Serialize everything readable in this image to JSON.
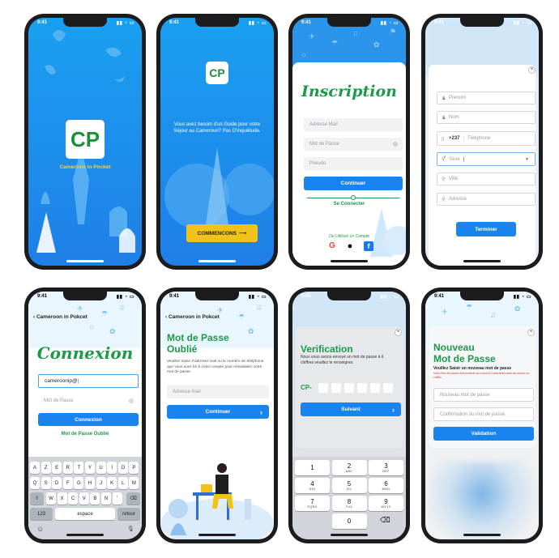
{
  "status_time": "9:41",
  "brand": {
    "name": "Cameroon in Pocket",
    "logo_letters": "CP",
    "green": "#1a8f3c",
    "yellow": "#f3c21a",
    "blue": "#1a84ee"
  },
  "splash": {
    "logo_caption": "Cameroon in Pocket"
  },
  "welcome": {
    "message": "Vous avez besoin d'un Guide pour votre Séjour au Cameroun? Pas D'inquiétude.",
    "cta_label": "COMMENCONS",
    "cta_arrow": "⟶"
  },
  "signup": {
    "title": "Inscription",
    "email_placeholder": "Adresse Mail",
    "password_placeholder": "Mot de Passe",
    "pseudo_placeholder": "Pseudo",
    "continue_label": "Continuer",
    "login_link": "Se Connecter",
    "social_caption": "Ou Utilisez un Compte"
  },
  "profile": {
    "firstname_placeholder": "Prénom",
    "lastname_placeholder": "Nom",
    "phone_code": "+237",
    "phone_placeholder": "Téléphone",
    "gender_placeholder": "Sexe",
    "city_placeholder": "Ville",
    "address_placeholder": "Adresse",
    "finish_label": "Terminer",
    "close_label": "×"
  },
  "login": {
    "back_label": "Cameroon in Pokcet",
    "title": "Connexion",
    "email_value": "cameroonip@",
    "password_placeholder": "Mot de Passe",
    "submit_label": "Connexion",
    "forgot_link": "Mot de Passe Oublié",
    "keyboard": {
      "row1": [
        "A",
        "Z",
        "E",
        "R",
        "T",
        "Y",
        "U",
        "I",
        "O",
        "P"
      ],
      "row2": [
        "Q",
        "S",
        "D",
        "F",
        "G",
        "H",
        "J",
        "K",
        "L",
        "M"
      ],
      "row3": [
        "W",
        "X",
        "C",
        "V",
        "B",
        "N",
        "'"
      ],
      "numbers_key": "123",
      "space_key": "espace",
      "return_key": "retour"
    }
  },
  "forgot": {
    "back_label": "Cameroon in Pokcet",
    "title_line1": "Mot de Passe",
    "title_line2": "Oublié",
    "description": "Veuillez saisir d'adresse mail ou le numéro de téléphone que vous avez lié à votre compte pour réinitialiser votre mot de passe.",
    "email_placeholder": "Adresse mail",
    "continue_label": "Continuer",
    "arrow": "›"
  },
  "verify": {
    "title": "Verification",
    "description": "Nous vous avons envoyé un mot de passe à 6 chiffres veuillez le renseigner.",
    "code_prefix": "CP-",
    "next_label": "Suivant",
    "arrow": "›",
    "close_label": "×",
    "numpad": [
      {
        "n": "1",
        "l": ""
      },
      {
        "n": "2",
        "l": "ABC"
      },
      {
        "n": "3",
        "l": "DEF"
      },
      {
        "n": "4",
        "l": "GHI"
      },
      {
        "n": "5",
        "l": "JKL"
      },
      {
        "n": "6",
        "l": "MNO"
      },
      {
        "n": "7",
        "l": "PQRS"
      },
      {
        "n": "8",
        "l": "TUV"
      },
      {
        "n": "9",
        "l": "WXYZ"
      },
      {
        "n": "0",
        "l": ""
      }
    ],
    "delete_key": "⌫"
  },
  "newpass": {
    "title_line1": "Nouveau",
    "title_line2": "Mot de Passe",
    "instruction": "Veuillez Saisir un nouveau mot de passe",
    "warning": "Votre Mot de passe doit contenir au moins 8 Caractères avec au moins un chiffre.",
    "new_placeholder": "Nouveau mot de passe",
    "confirm_placeholder": "Confirmation du mot de passe",
    "submit_label": "Validation",
    "close_label": "×"
  }
}
